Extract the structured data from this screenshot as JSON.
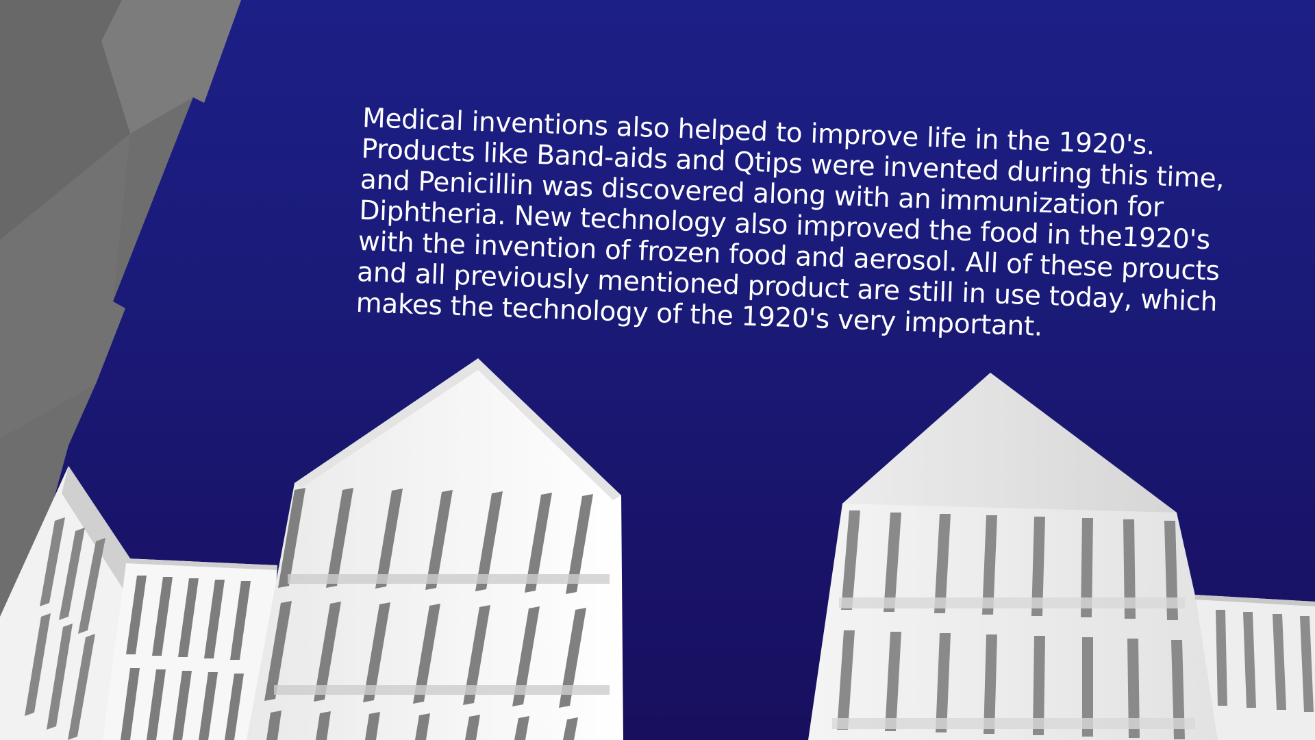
{
  "slide": {
    "caption_lines": [
      "Medical inventions also helped to improve life in the 1920's.",
      "Products like Band-aids and Qtips were invented during this time,",
      "and Penicillin was discovered along with an immunization for",
      "Diphtheria.  New technology also improved the food in the1920's",
      "with the invention of frozen food and aerosol.  All of these proucts",
      "and all previously mentioned product are still in use today, which",
      "makes the technology of the 1920's very important."
    ]
  },
  "colors": {
    "sky_top": "#1c1f86",
    "sky_bottom": "#180f5e",
    "text": "#ffffff",
    "building_light": "#f6f6f6",
    "building_shadow": "#7c7c7c",
    "tower_grey": "#6f6f6f"
  }
}
